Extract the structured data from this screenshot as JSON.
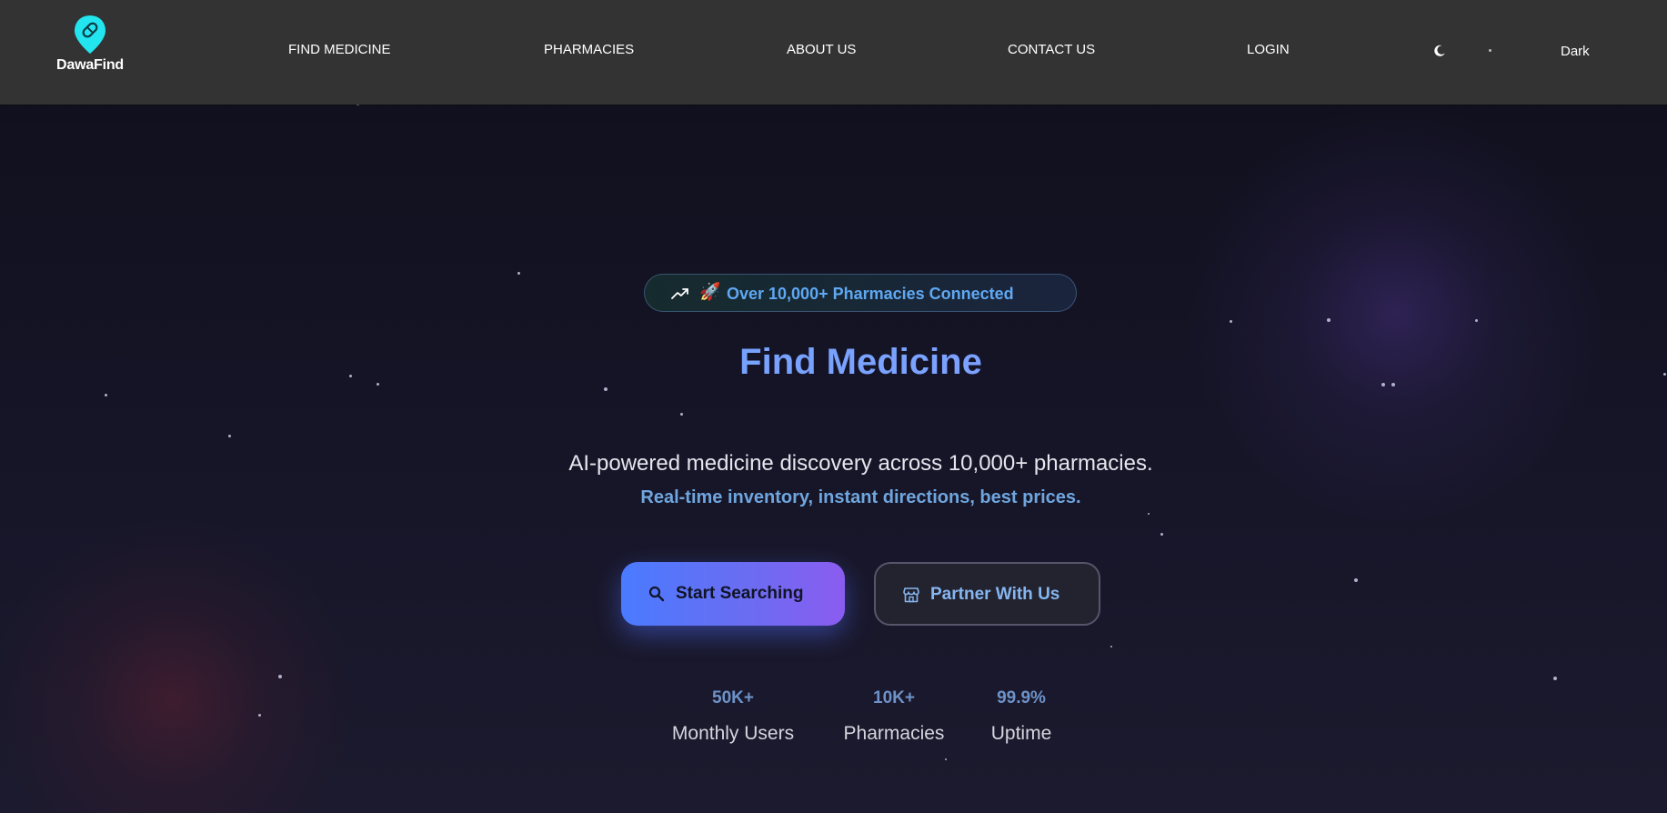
{
  "navbar": {
    "logo_text": "DawaFind",
    "logo_icon": "pill-location-pin-icon",
    "links": [
      {
        "label": "FIND MEDICINE"
      },
      {
        "label": "PHARMACIES"
      },
      {
        "label": "ABOUT US"
      },
      {
        "label": "CONTACT US"
      },
      {
        "label": "LOGIN"
      }
    ],
    "theme_toggle_icon": "moon-icon",
    "theme_label": "Dark"
  },
  "hero": {
    "badge": {
      "icon": "trending-up-icon",
      "emoji": "🚀",
      "text": "Over 10,000+ Pharmacies Connected"
    },
    "title": "Find Medicine",
    "subtitle": "AI-powered medicine discovery across 10,000+ pharmacies.",
    "tagline": "Real-time inventory, instant directions, best prices.",
    "primary_button": {
      "label": "Start Searching",
      "icon": "search-icon"
    },
    "secondary_button": {
      "label": "Partner With Us",
      "icon": "store-icon"
    },
    "stats": [
      {
        "value": "50K+",
        "label": "Monthly Users"
      },
      {
        "value": "10K+",
        "label": "Pharmacies"
      },
      {
        "value": "99.9%",
        "label": "Uptime"
      }
    ]
  },
  "colors": {
    "navbar_bg": "#333333",
    "page_bg": "#13121f",
    "accent_blue": "#60a5fa",
    "accent_purple": "#8b5cf6",
    "logo_cyan": "#22e5f0",
    "tagline": "#6fa6de"
  }
}
